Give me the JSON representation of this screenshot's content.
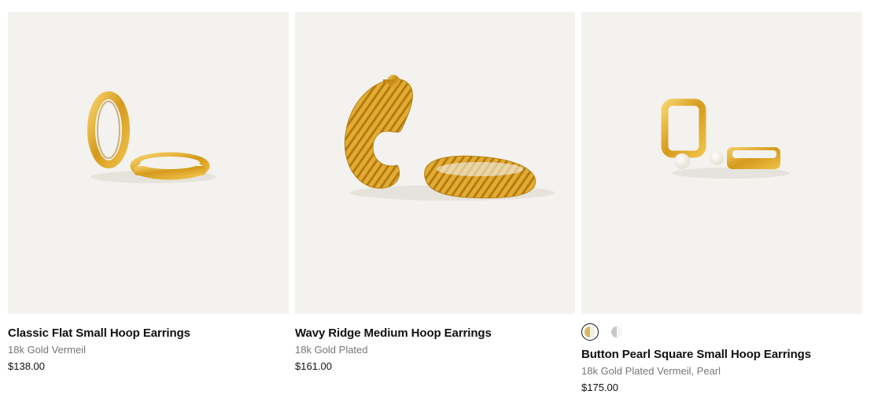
{
  "products": [
    {
      "title": "Classic Flat Small Hoop Earrings",
      "material": "18k Gold Vermeil",
      "price": "$138.00",
      "image": "gold-flat-hoop-earrings-image"
    },
    {
      "title": "Wavy Ridge Medium Hoop Earrings",
      "material": "18k Gold Plated",
      "price": "$161.00",
      "image": "gold-ridged-hoop-earrings-image"
    },
    {
      "title": "Button Pearl Square Small Hoop Earrings",
      "material": "18k Gold Plated Vermeil, Pearl",
      "price": "$175.00",
      "image": "gold-square-pearl-hoop-earrings-image",
      "swatches": [
        {
          "name": "gold-pearl",
          "colors": [
            "#d9b861",
            "#f4efe4"
          ],
          "selected": true
        },
        {
          "name": "silver-pearl",
          "colors": [
            "#c9c9c9",
            "#f4f4f4"
          ],
          "selected": false
        }
      ]
    }
  ],
  "colors": {
    "image_background": "#f3f2ef",
    "gold": "#d9a628",
    "title_text": "#111111",
    "material_text": "#777777"
  }
}
